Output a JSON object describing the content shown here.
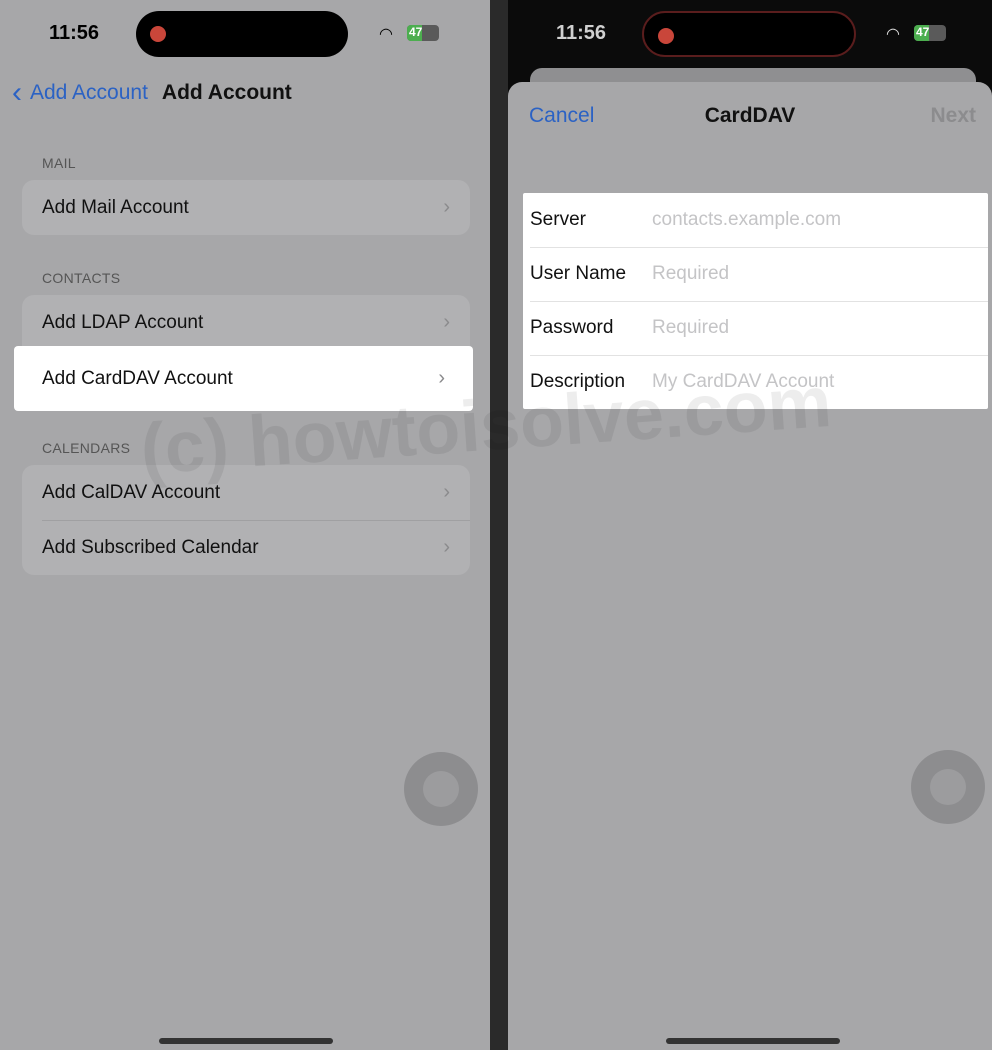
{
  "watermark": "(c) howtoisolve.com",
  "left": {
    "status": {
      "time": "11:56",
      "battery": "47",
      "battery_level": 47
    },
    "nav": {
      "back_label": "Add Account",
      "title": "Add Account"
    },
    "sections": [
      {
        "header": "MAIL",
        "items": [
          "Add Mail Account"
        ]
      },
      {
        "header": "CONTACTS",
        "items": [
          "Add LDAP Account",
          "Add CardDAV Account"
        ]
      },
      {
        "header": "CALENDARS",
        "items": [
          "Add CalDAV Account",
          "Add Subscribed Calendar"
        ]
      }
    ],
    "highlighted_item": "Add CardDAV Account"
  },
  "right": {
    "status": {
      "time": "11:56",
      "battery": "47",
      "battery_level": 47
    },
    "sheet": {
      "cancel_label": "Cancel",
      "title": "CardDAV",
      "next_label": "Next"
    },
    "fields": [
      {
        "label": "Server",
        "value": "",
        "placeholder": "contacts.example.com"
      },
      {
        "label": "User Name",
        "value": "",
        "placeholder": "Required"
      },
      {
        "label": "Password",
        "value": "",
        "placeholder": "Required"
      },
      {
        "label": "Description",
        "value": "",
        "placeholder": "My CardDAV Account"
      }
    ]
  },
  "colors": {
    "accent": "#2b62c4",
    "recording": "#c9463a",
    "battery": "#4cae4f"
  }
}
